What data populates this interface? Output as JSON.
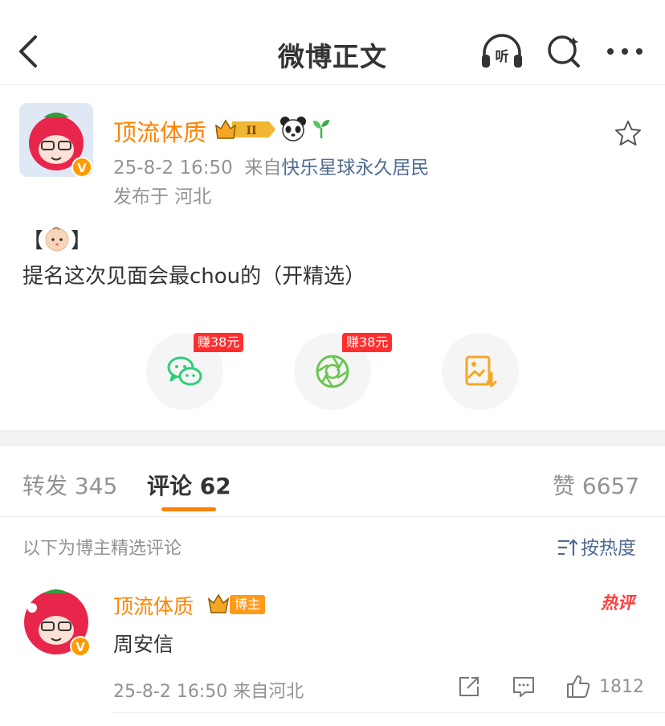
{
  "header": {
    "title": "微博正文"
  },
  "post": {
    "author": "顶流体质",
    "rank_badge": "II",
    "time": "25-8-2 16:50",
    "source_prefix": "来自",
    "source": "快乐星球永久居民",
    "location": "发布于 河北",
    "text_open": "【",
    "text_close": "】",
    "text_line2": "提名这次见面会最chou的（开精选）"
  },
  "share": {
    "wechat_earn": "赚38元",
    "moments_earn": "赚38元"
  },
  "tabs": {
    "repost": "转发 345",
    "comments": "评论 62",
    "likes": "赞 6657"
  },
  "comments_section": {
    "featured_note": "以下为博主精选评论",
    "sort_label": "按热度"
  },
  "comment": {
    "author": "顶流体质",
    "owner_tag": "博主",
    "hot_tag": "热评",
    "text": "周安信",
    "meta": "25-8-2 16:50 来自河北",
    "likes": "1812"
  },
  "colors": {
    "accent": "#ff8200",
    "link": "#506b91",
    "earn_badge": "#ff2e2e",
    "wechat_green": "#2bcf7a"
  }
}
